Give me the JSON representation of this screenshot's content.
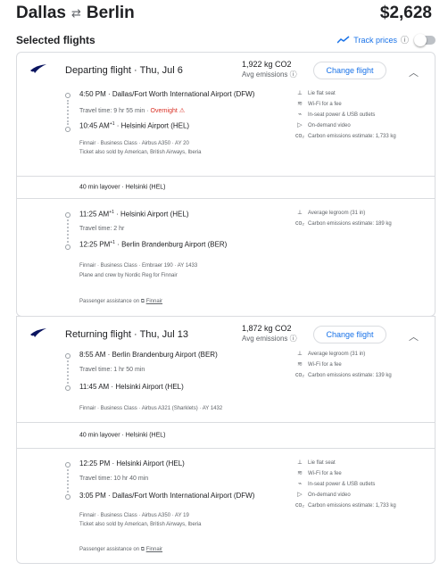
{
  "header": {
    "origin": "Dallas",
    "destination": "Berlin",
    "swap_icon": "swap-arrows-icon",
    "total_price": "$2,628"
  },
  "selected": {
    "title": "Selected flights",
    "track_label": "Track prices",
    "track_icon": "trend-icon"
  },
  "departing": {
    "title": "Departing flight · Thu, Jul 6",
    "co2": "1,922 kg CO2",
    "co2_sub": "Avg emissions",
    "change_label": "Change flight",
    "seg1": {
      "dep": "4:50 PM · Dallas/Fort Worth International Airport (DFW)",
      "travel": "Travel time: 9 hr 55 min · ",
      "overnight": "Overnight",
      "arr_time": "10:45 AM",
      "arr_sup": "+1",
      "arr_rest": " · Helsinki Airport (HEL)",
      "meta1": "Finnair · Business Class · Airbus A350 · AY 20",
      "meta2": "Ticket also sold by American, British Airways, Iberia",
      "amenities": [
        "Lie flat seat",
        "Wi-Fi for a fee",
        "In-seat power & USB outlets",
        "On-demand video",
        "Carbon emissions estimate: 1,733 kg"
      ]
    },
    "layover": "40 min layover · Helsinki (HEL)",
    "seg2": {
      "dep_time": "11:25 AM",
      "dep_sup": "+1",
      "dep_rest": " · Helsinki Airport (HEL)",
      "travel": "Travel time: 2 hr",
      "arr_time": "12:25 PM",
      "arr_sup": "+1",
      "arr_rest": " · Berlin Brandenburg Airport (BER)",
      "meta1": "Finnair · Business Class · Embraer 190 · AY 1433",
      "meta2": "Plane and crew by Nordic Reg for Finnair",
      "amenities": [
        "Average legroom (31 in)",
        "Carbon emissions estimate: 189 kg"
      ]
    },
    "assist_label": "Passenger assistance on ",
    "assist_link": "Finnair"
  },
  "returning": {
    "title": "Returning flight · Thu, Jul 13",
    "co2": "1,872 kg CO2",
    "co2_sub": "Avg emissions",
    "change_label": "Change flight",
    "seg1": {
      "dep": "8:55 AM · Berlin Brandenburg Airport (BER)",
      "travel": "Travel time: 1 hr 50 min",
      "arr": "11:45 AM · Helsinki Airport (HEL)",
      "meta1": "Finnair · Business Class · Airbus A321 (Sharklets) · AY 1432",
      "amenities": [
        "Average legroom (31 in)",
        "Wi-Fi for a fee",
        "Carbon emissions estimate: 139 kg"
      ]
    },
    "layover": "40 min layover · Helsinki (HEL)",
    "seg2": {
      "dep": "12:25 PM · Helsinki Airport (HEL)",
      "travel": "Travel time: 10 hr 40 min",
      "arr": "3:05 PM · Dallas/Fort Worth International Airport (DFW)",
      "meta1": "Finnair · Business Class · Airbus A350 · AY 19",
      "meta2": "Ticket also sold by American, British Airways, Iberia",
      "amenities": [
        "Lie flat seat",
        "Wi-Fi for a fee",
        "In-seat power & USB outlets",
        "On-demand video",
        "Carbon emissions estimate: 1,733 kg"
      ]
    },
    "assist_label": "Passenger assistance on ",
    "assist_link": "Finnair"
  },
  "colors": {
    "accent": "#1a73e8",
    "warning": "#d93025",
    "muted": "#5f6368",
    "border": "#dadce0"
  }
}
